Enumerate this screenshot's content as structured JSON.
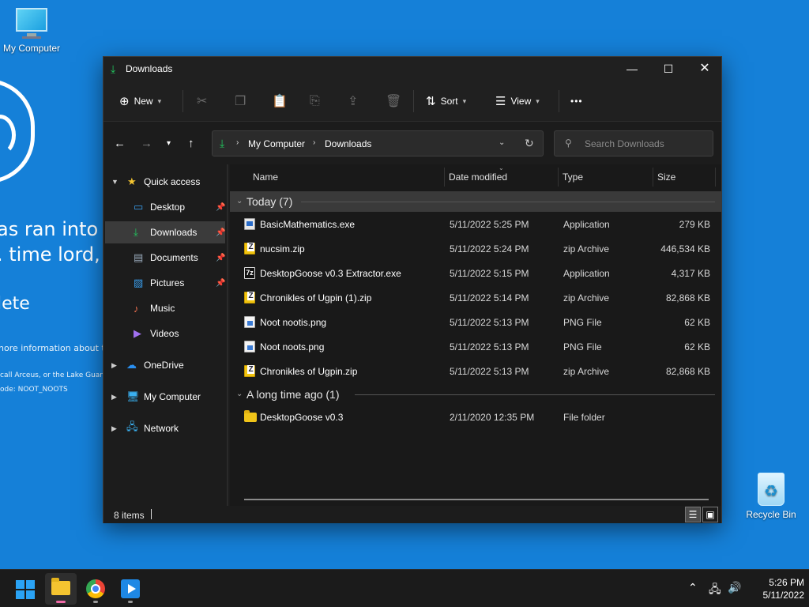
{
  "desktop": {
    "icons": [
      {
        "label": "My Computer"
      },
      {
        "label": "Recycle Bin"
      }
    ],
    "bsod_text": [
      "as ran into",
      ". time lord,",
      "lete",
      "nore information about th",
      "call Arceus, or the Lake Guar",
      "ode: NOOT_NOOTS"
    ]
  },
  "window": {
    "title": "Downloads",
    "controls": {
      "minimize": "—",
      "maximize": "☐",
      "close": "✕"
    }
  },
  "command_bar": {
    "new_label": "New",
    "sort_label": "Sort",
    "view_label": "View",
    "more_label": "•••"
  },
  "navigation": {
    "breadcrumb": [
      "My Computer",
      "Downloads"
    ],
    "search_placeholder": "Search Downloads"
  },
  "sidebar": {
    "items": [
      {
        "label": "Quick access",
        "icon": "star-icon"
      },
      {
        "label": "Desktop",
        "icon": "desktop-icon",
        "pinned": true
      },
      {
        "label": "Downloads",
        "icon": "download-icon",
        "pinned": true,
        "selected": true
      },
      {
        "label": "Documents",
        "icon": "documents-icon",
        "pinned": true
      },
      {
        "label": "Pictures",
        "icon": "pictures-icon",
        "pinned": true
      },
      {
        "label": "Music",
        "icon": "music-icon"
      },
      {
        "label": "Videos",
        "icon": "videos-icon"
      },
      {
        "label": "OneDrive",
        "icon": "onedrive-icon"
      },
      {
        "label": "My Computer",
        "icon": "computer-icon"
      },
      {
        "label": "Network",
        "icon": "network-icon"
      }
    ]
  },
  "columns": [
    "Name",
    "Date modified",
    "Type",
    "Size"
  ],
  "groups": [
    {
      "label": "Today (7)",
      "files": [
        {
          "name": "BasicMathematics.exe",
          "date": "5/11/2022 5:25 PM",
          "type": "Application",
          "size": "279 KB",
          "icon": "exe-icon"
        },
        {
          "name": "nucsim.zip",
          "date": "5/11/2022 5:24 PM",
          "type": "zip Archive",
          "size": "446,534 KB",
          "icon": "zip-icon"
        },
        {
          "name": "DesktopGoose v0.3 Extractor.exe",
          "date": "5/11/2022 5:15 PM",
          "type": "Application",
          "size": "4,317 KB",
          "icon": "7z-icon"
        },
        {
          "name": "Chronikles of Ugpin (1).zip",
          "date": "5/11/2022 5:14 PM",
          "type": "zip Archive",
          "size": "82,868 KB",
          "icon": "zip-icon"
        },
        {
          "name": "Noot nootis.png",
          "date": "5/11/2022 5:13 PM",
          "type": "PNG File",
          "size": "62 KB",
          "icon": "png-icon"
        },
        {
          "name": "Noot noots.png",
          "date": "5/11/2022 5:13 PM",
          "type": "PNG File",
          "size": "62 KB",
          "icon": "png-icon"
        },
        {
          "name": "Chronikles of Ugpin.zip",
          "date": "5/11/2022 5:13 PM",
          "type": "zip Archive",
          "size": "82,868 KB",
          "icon": "zip-icon"
        }
      ]
    },
    {
      "label": "A long time ago (1)",
      "files": [
        {
          "name": "DesktopGoose v0.3",
          "date": "2/11/2020 12:35 PM",
          "type": "File folder",
          "size": "",
          "icon": "folder-icon"
        }
      ]
    }
  ],
  "status": {
    "item_count": "8 items"
  },
  "taskbar": {
    "time": "5:26 PM",
    "date": "5/11/2022"
  }
}
